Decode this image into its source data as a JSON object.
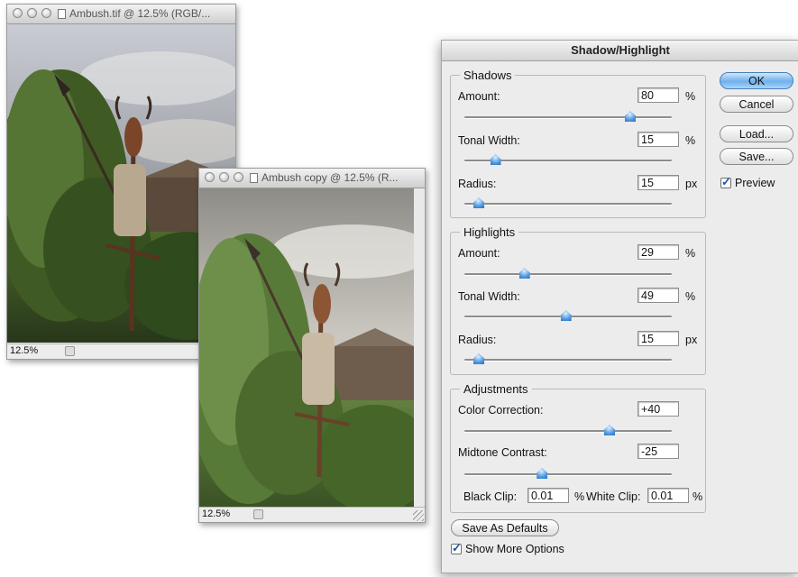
{
  "window1": {
    "title": "Ambush.tif @ 12.5% (RGB/...",
    "zoom": "12.5%"
  },
  "window2": {
    "title": "Ambush copy @ 12.5% (R...",
    "zoom": "12.5%"
  },
  "dialog": {
    "title": "Shadow/Highlight",
    "buttons": {
      "ok": "OK",
      "cancel": "Cancel",
      "load": "Load...",
      "save": "Save...",
      "save_defaults": "Save As Defaults"
    },
    "preview": {
      "label": "Preview",
      "checked": true
    },
    "show_more": {
      "label": "Show More Options",
      "checked": true
    },
    "shadows": {
      "title": "Shadows",
      "amount": {
        "label": "Amount:",
        "value": "80",
        "unit": "%",
        "level": 0.8
      },
      "tonal_width": {
        "label": "Tonal Width:",
        "value": "15",
        "unit": "%",
        "level": 0.15
      },
      "radius": {
        "label": "Radius:",
        "value": "15",
        "unit": "px",
        "level": 0.07
      }
    },
    "highlights": {
      "title": "Highlights",
      "amount": {
        "label": "Amount:",
        "value": "29",
        "unit": "%",
        "level": 0.29
      },
      "tonal_width": {
        "label": "Tonal Width:",
        "value": "49",
        "unit": "%",
        "level": 0.49
      },
      "radius": {
        "label": "Radius:",
        "value": "15",
        "unit": "px",
        "level": 0.07
      }
    },
    "adjustments": {
      "title": "Adjustments",
      "color_correction": {
        "label": "Color Correction:",
        "value": "+40",
        "level": 0.7
      },
      "midtone_contrast": {
        "label": "Midtone Contrast:",
        "value": "-25",
        "level": 0.375
      },
      "black_clip": {
        "label": "Black Clip:",
        "value": "0.01",
        "unit": "%"
      },
      "white_clip": {
        "label": "White Clip:",
        "value": "0.01",
        "unit": "%"
      }
    }
  }
}
